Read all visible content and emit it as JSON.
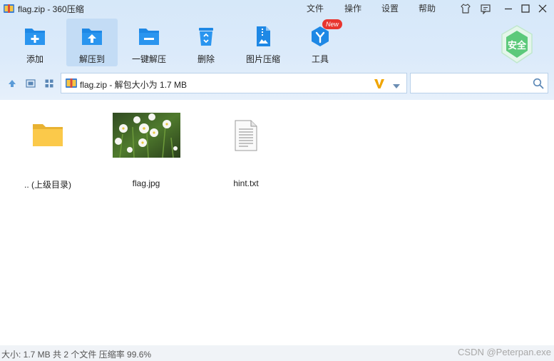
{
  "window": {
    "title": "flag.zip - 360压缩"
  },
  "menu": {
    "file": "文件",
    "operation": "操作",
    "settings": "设置",
    "help": "帮助"
  },
  "toolbar": {
    "add": "添加",
    "extract_to": "解压到",
    "one_click_extract": "一键解压",
    "delete": "删除",
    "image_compress": "图片压缩",
    "tools": "工具",
    "new_badge": "New",
    "security_badge": "安全"
  },
  "address": {
    "path": "flag.zip - 解包大小为 1.7 MB",
    "search_placeholder": "",
    "v_icon": "V"
  },
  "files": [
    {
      "name": ".. (上级目录)",
      "type": "parent-folder"
    },
    {
      "name": "flag.jpg",
      "type": "image"
    },
    {
      "name": "hint.txt",
      "type": "text"
    }
  ],
  "status": {
    "summary": "大小: 1.7 MB 共 2 个文件 压缩率 99.6%",
    "watermark": "CSDN @Peterpan.exe"
  },
  "colors": {
    "accent_blue": "#1e88e5",
    "shield_green": "#5cc97a",
    "new_badge": "#e8352f",
    "folder_yellow": "#fbc94a"
  }
}
